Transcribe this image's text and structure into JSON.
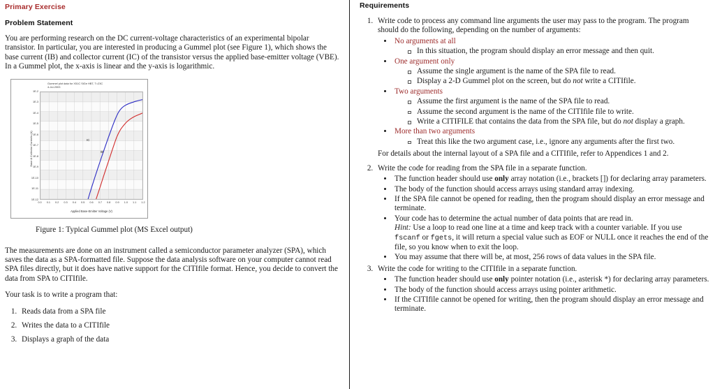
{
  "left": {
    "heading_primary": "Primary Exercise",
    "heading_problem": "Problem Statement",
    "intro_paragraph": "You are performing research on the DC current-voltage characteristics of an experimental bipolar transistor. In particular, you are interested in producing a Gummel plot (see Figure 1), which shows the base current (IB) and collector current (IC) of the transistor versus the applied base-emitter voltage (VBE). In a Gummel plot, the x-axis is linear and the y-axis is logarithmic.",
    "figure_caption": "Figure 1: Typical Gummel plot (MS Excel output)",
    "measurements_paragraph": "The measurements are done on an instrument called a semiconductor parameter analyzer (SPA), which saves the data as a SPA-formatted file.  Suppose the data analysis software on your computer cannot read SPA files directly, but it does have native support for the CITIfile format. Hence, you decide to convert the data from SPA to CITIfile.",
    "task_lead": "Your task is to write a program that:",
    "tasks": [
      "Reads data from a SPA file",
      "Writes the data to a CITIfile",
      "Displays a graph of the data"
    ]
  },
  "right": {
    "heading_requirements": "Requirements",
    "req1": {
      "text": "Write code to process any command line arguments the user may pass to the program. The program should do the following, depending on the number of arguments:",
      "groups": [
        {
          "label": "No arguments at all",
          "items": [
            "In this situation, the program should display an error message and then quit."
          ]
        },
        {
          "label": "One argument only",
          "items": [
            "Assume the single argument is the name of the SPA file to read.",
            "Display a 2-D Gummel plot on the screen, but do not write a CITIfile."
          ]
        },
        {
          "label": "Two arguments",
          "items": [
            "Assume the first argument is the name of the SPA file to read.",
            "Assume the second argument is the name of the CITIfile file to write.",
            "Write a CITIFILE that contains the data from the SPA file, but do not display a graph."
          ]
        },
        {
          "label": "More than two arguments",
          "items": [
            "Treat this like the two argument case, i.e., ignore any arguments after the first two."
          ]
        }
      ],
      "closing": "For details about the internal layout of a SPA file and a CITIfile, refer to Appendices 1 and 2."
    },
    "req2": {
      "text": "Write the code for reading from the SPA file in a separate function.",
      "bullets": [
        "The function header should use only array notation (i.e., brackets []) for declaring array parameters.",
        "The body of the function should access arrays using standard array indexing.",
        "If the SPA file cannot be opened for reading, then the program should display an error message and terminate.",
        "Your code has to determine the actual number of data points that are read in.",
        "You may assume that there will be, at most, 256 rows of data values in the SPA file."
      ],
      "hint_label": "Hint:",
      "hint_text_a": " Use a loop to read one line at a time and keep track with a counter variable. If you use ",
      "hint_code_a": "fscanf",
      "hint_text_b": " or ",
      "hint_code_b": "fgets",
      "hint_text_c": ", it will return a special value such as EOF or NULL once it reaches the end of the file, so you know when to exit the loop."
    },
    "req3": {
      "text": "Write the code for writing to the CITIfile in a separate function.",
      "bullets": [
        "The function header should use only pointer notation (i.e., asterisk *) for declaring array parameters.",
        "The body of the function should access arrays using pointer arithmetic.",
        "If the CITIfile cannot be opened for writing, then the program should display an error message and terminate."
      ]
    },
    "emphasis": {
      "only": "only",
      "not": "not"
    }
  },
  "chart_data": {
    "type": "line",
    "title": "Gummel plot data for X51C SiGe HBT, T=23C\n4-Jul-2003",
    "xlabel": "Applied Base-Emitter Voltage (V)",
    "ylabel": "Base & Collector Currents (A)",
    "xlim": [
      0.0,
      1.2
    ],
    "ylim_log": [
      1e-12,
      0.01
    ],
    "xticks": [
      "0.0",
      "0.1",
      "0.2",
      "0.3",
      "0.4",
      "0.5",
      "0.6",
      "0.7",
      "0.8",
      "0.9",
      "1.0",
      "1.1",
      "1.2"
    ],
    "yticks": [
      "1E-2",
      "1E-3",
      "1E-4",
      "1E-5",
      "1E-6",
      "1E-7",
      "1E-8",
      "1E-9",
      "1E-10",
      "1E-11",
      "1E-12"
    ],
    "grid": true,
    "legend_position": "inline-annotation",
    "series": [
      {
        "name": "IC",
        "color": "#2b2bc4",
        "x": [
          0.56,
          0.6,
          0.64,
          0.68,
          0.72,
          0.76,
          0.8,
          0.84,
          0.88,
          0.92,
          0.96,
          1.0,
          1.04,
          1.08,
          1.12,
          1.16,
          1.2
        ],
        "y": [
          1e-12,
          1.1e-11,
          1.1e-10,
          1e-09,
          9e-09,
          7.5e-08,
          6e-07,
          4.5e-06,
          3e-05,
          0.00014,
          0.00035,
          0.0006,
          0.00085,
          0.0011,
          0.0014,
          0.0017,
          0.002
        ]
      },
      {
        "name": "IB",
        "color": "#d12b2b",
        "x": [
          0.655,
          0.7,
          0.74,
          0.78,
          0.82,
          0.86,
          0.9,
          0.94,
          0.98,
          1.02,
          1.06,
          1.1,
          1.14,
          1.18,
          1.2
        ],
        "y": [
          1e-12,
          1.2e-11,
          1.2e-10,
          1.1e-09,
          1e-08,
          9e-08,
          7e-07,
          3e-06,
          8e-06,
          1.8e-05,
          3.2e-05,
          5e-05,
          7e-05,
          9.5e-05,
          0.00011
        ]
      }
    ],
    "annotations": [
      {
        "text": "IC",
        "x": 0.8,
        "y": 3e-06
      },
      {
        "text": "IB",
        "x": 0.93,
        "y": 1.3e-06
      }
    ]
  }
}
